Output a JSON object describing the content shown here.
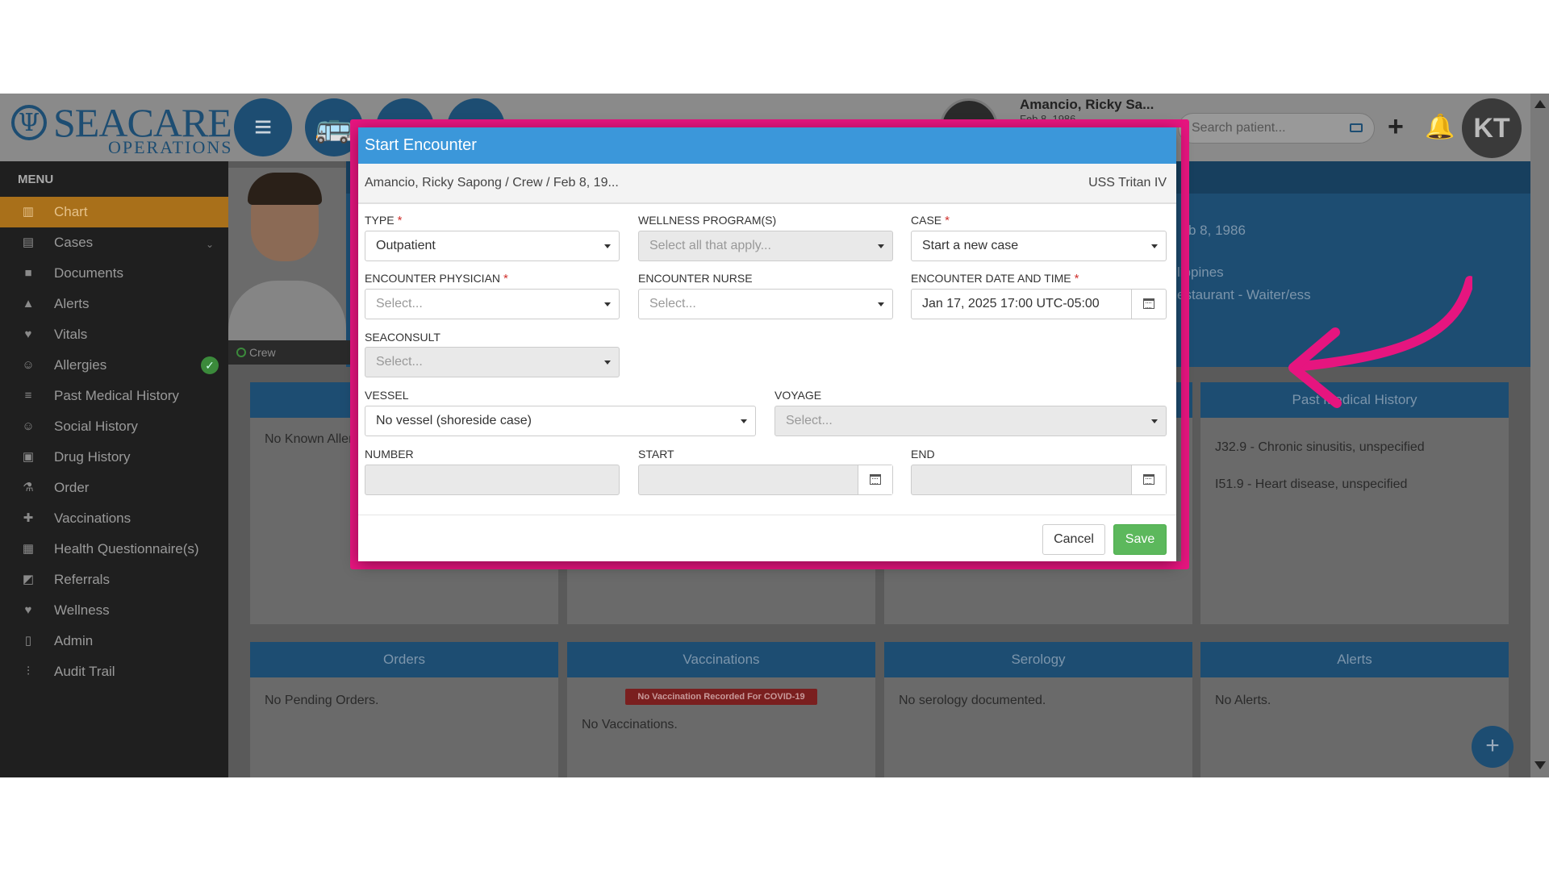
{
  "app": {
    "logo_text": "SEACARE",
    "logo_sub": "OPERATIONS"
  },
  "header": {
    "patient_name": "Amancio, Ricky Sa...",
    "patient_dob": "Feb 8, 1986",
    "search_placeholder": "Search patient...",
    "user_initials": "KT"
  },
  "sidebar": {
    "title": "MENU",
    "items": [
      {
        "label": "Chart",
        "icon": "chart-icon"
      },
      {
        "label": "Cases",
        "icon": "cases-icon"
      },
      {
        "label": "Documents",
        "icon": "folder-icon"
      },
      {
        "label": "Alerts",
        "icon": "warning-icon"
      },
      {
        "label": "Vitals",
        "icon": "heart-icon"
      },
      {
        "label": "Allergies",
        "icon": "allergy-icon"
      },
      {
        "label": "Past Medical History",
        "icon": "history-icon"
      },
      {
        "label": "Social History",
        "icon": "social-icon"
      },
      {
        "label": "Drug History",
        "icon": "pill-icon"
      },
      {
        "label": "Order",
        "icon": "flask-icon"
      },
      {
        "label": "Vaccinations",
        "icon": "syringe-icon"
      },
      {
        "label": "Health Questionnaire(s)",
        "icon": "questionnaire-icon"
      },
      {
        "label": "Referrals",
        "icon": "referral-icon"
      },
      {
        "label": "Wellness",
        "icon": "wellness-icon"
      },
      {
        "label": "Admin",
        "icon": "file-icon"
      },
      {
        "label": "Audit Trail",
        "icon": "audit-icon"
      }
    ]
  },
  "profile": {
    "crew_label": "Crew",
    "dob_partial": "b 8, 1986",
    "country_partial": "lippines",
    "occupation_partial": "estaurant - Waiter/ess"
  },
  "panels": {
    "allergies_text": "No Known Allergies",
    "pmh_title": "Past Medical History",
    "pmh_items": [
      "J32.9 - Chronic sinusitis, unspecified",
      "I51.9 - Heart disease, unspecified"
    ],
    "orders_title": "Orders",
    "orders_text": "No Pending Orders.",
    "vaccinations_title": "Vaccinations",
    "covid_badge": "No Vaccination Recorded For COVID-19",
    "vaccinations_text": "No Vaccinations.",
    "serology_title": "Serology",
    "serology_text": "No serology documented.",
    "alerts_title": "Alerts",
    "alerts_text": "No Alerts."
  },
  "modal": {
    "title": "Start Encounter",
    "patient_line": "Amancio, Ricky Sapong / Crew / Feb 8, 19...",
    "vessel_name": "USS Tritan IV",
    "fields": {
      "type_label": "TYPE",
      "type_value": "Outpatient",
      "wellness_label": "WELLNESS PROGRAM(S)",
      "wellness_placeholder": "Select all that apply...",
      "case_label": "CASE",
      "case_value": "Start a new case",
      "physician_label": "ENCOUNTER PHYSICIAN",
      "physician_placeholder": "Select...",
      "nurse_label": "ENCOUNTER NURSE",
      "nurse_placeholder": "Select...",
      "datetime_label": "ENCOUNTER DATE AND TIME",
      "datetime_value": "Jan 17, 2025 17:00 UTC-05:00",
      "seaconsult_label": "SEACONSULT",
      "seaconsult_placeholder": "Select...",
      "vessel_label": "VESSEL",
      "vessel_value": "No vessel (shoreside case)",
      "voyage_label": "VOYAGE",
      "voyage_placeholder": "Select...",
      "number_label": "NUMBER",
      "start_label": "START",
      "end_label": "END"
    },
    "required_mark": "*",
    "cancel_label": "Cancel",
    "save_label": "Save"
  },
  "colors": {
    "modal_header": "#3b97da",
    "highlight": "#e6157f",
    "save_button": "#5cb85c",
    "navy": "#1d4d72",
    "active_menu": "#a9701a"
  }
}
